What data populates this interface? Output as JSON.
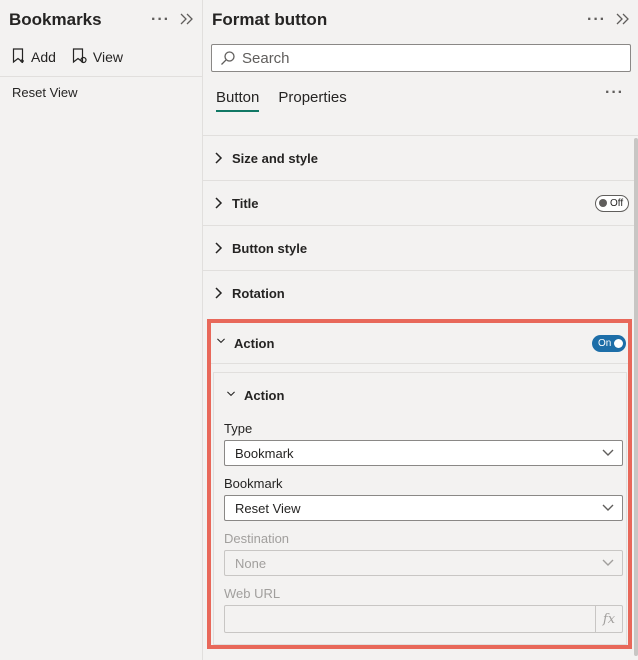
{
  "bookmarks": {
    "title": "Bookmarks",
    "add_label": "Add",
    "view_label": "View",
    "items": [
      {
        "label": "Reset View"
      }
    ]
  },
  "format": {
    "title": "Format button",
    "search_placeholder": "Search",
    "tabs": [
      {
        "label": "Button"
      },
      {
        "label": "Properties"
      }
    ],
    "sections": [
      {
        "label": "Size and style"
      },
      {
        "label": "Title",
        "toggle": "Off"
      },
      {
        "label": "Button style"
      },
      {
        "label": "Rotation"
      }
    ],
    "action": {
      "label": "Action",
      "toggle": "On",
      "inner_label": "Action",
      "type_label": "Type",
      "type_value": "Bookmark",
      "bookmark_label": "Bookmark",
      "bookmark_value": "Reset View",
      "destination_label": "Destination",
      "destination_value": "None",
      "weburl_label": "Web URL",
      "fx_label": "fx"
    }
  },
  "colors": {
    "accent_tab": "#117865",
    "toggle_on": "#1d6ea8",
    "highlight_border": "#e8685a"
  },
  "icons": [
    "more-icon",
    "expand-icon",
    "add-bookmark-icon",
    "view-icon",
    "search-icon",
    "chevron-right-icon",
    "chevron-down-icon"
  ]
}
